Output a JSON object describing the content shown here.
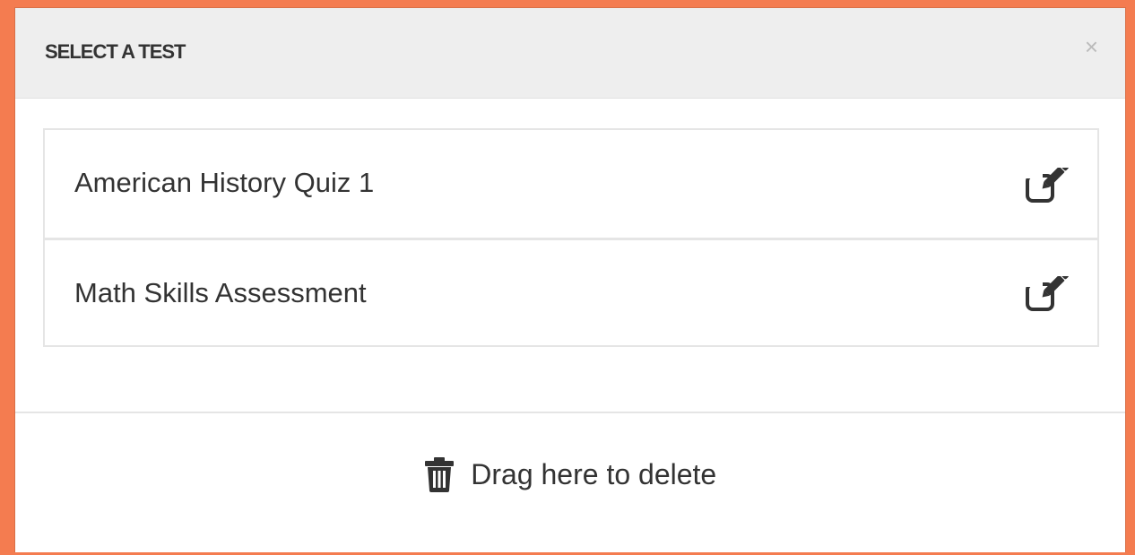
{
  "modal": {
    "title": "SELECT A TEST",
    "close_label": "×"
  },
  "tests": [
    {
      "label": "American History Quiz 1",
      "action_icon": "edit-icon"
    },
    {
      "label": "Math Skills Assessment",
      "action_icon": "edit-icon"
    }
  ],
  "footer": {
    "delete_label": "Drag here to delete",
    "delete_icon": "trash-icon"
  },
  "colors": {
    "page_background": "#f47c50",
    "header_background": "#eeeeee",
    "text": "#333333"
  }
}
